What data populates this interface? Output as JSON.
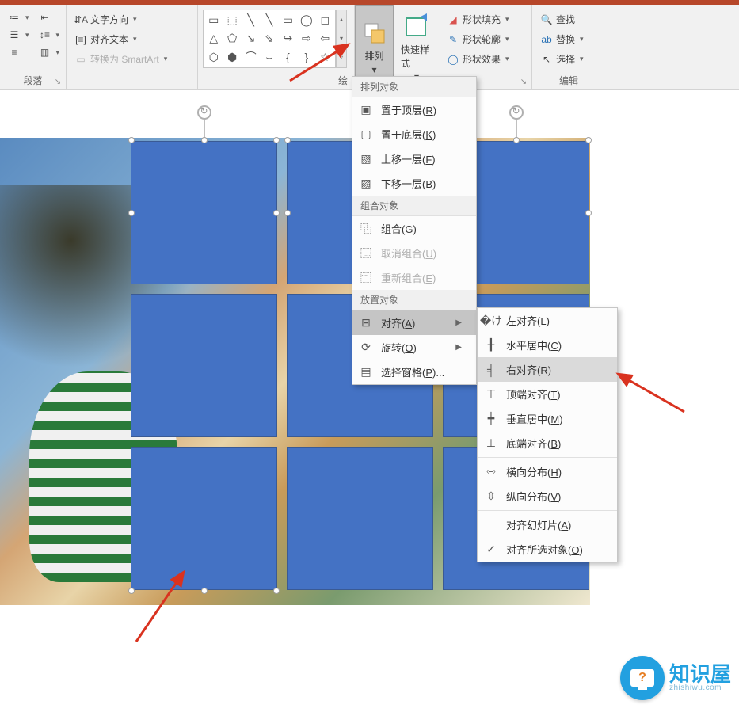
{
  "ribbon": {
    "paragraph": {
      "label": "段落",
      "text_direction": "文字方向",
      "align_text": "对齐文本",
      "convert_smartart": "转换为 SmartArt"
    },
    "shapes_group_end_label": "绘",
    "arrange": {
      "label": "排列"
    },
    "quick_styles": {
      "label": "快速样式"
    },
    "shape_format": {
      "fill": "形状填充",
      "outline": "形状轮廓",
      "effects": "形状效果"
    },
    "editing": {
      "label": "编辑",
      "find": "查找",
      "replace": "替换",
      "select": "选择"
    }
  },
  "menu1": {
    "header_arrange": "排列对象",
    "bring_front": "置于顶层(R)",
    "send_back": "置于底层(K)",
    "bring_forward": "上移一层(F)",
    "send_backward": "下移一层(B)",
    "header_group": "组合对象",
    "group": "组合(G)",
    "ungroup": "取消组合(U)",
    "regroup": "重新组合(E)",
    "header_position": "放置对象",
    "align": "对齐(A)",
    "rotate": "旋转(O)",
    "selection_pane": "选择窗格(P)..."
  },
  "menu2": {
    "align_left": "左对齐(L)",
    "align_center": "水平居中(C)",
    "align_right": "右对齐(R)",
    "align_top": "顶端对齐(T)",
    "align_middle": "垂直居中(M)",
    "align_bottom": "底端对齐(B)",
    "dist_h": "横向分布(H)",
    "dist_v": "纵向分布(V)",
    "align_slide": "对齐幻灯片(A)",
    "align_selected": "对齐所选对象(O)"
  },
  "logo": {
    "brand": "知识屋",
    "domain": "zhishiwu.com"
  }
}
